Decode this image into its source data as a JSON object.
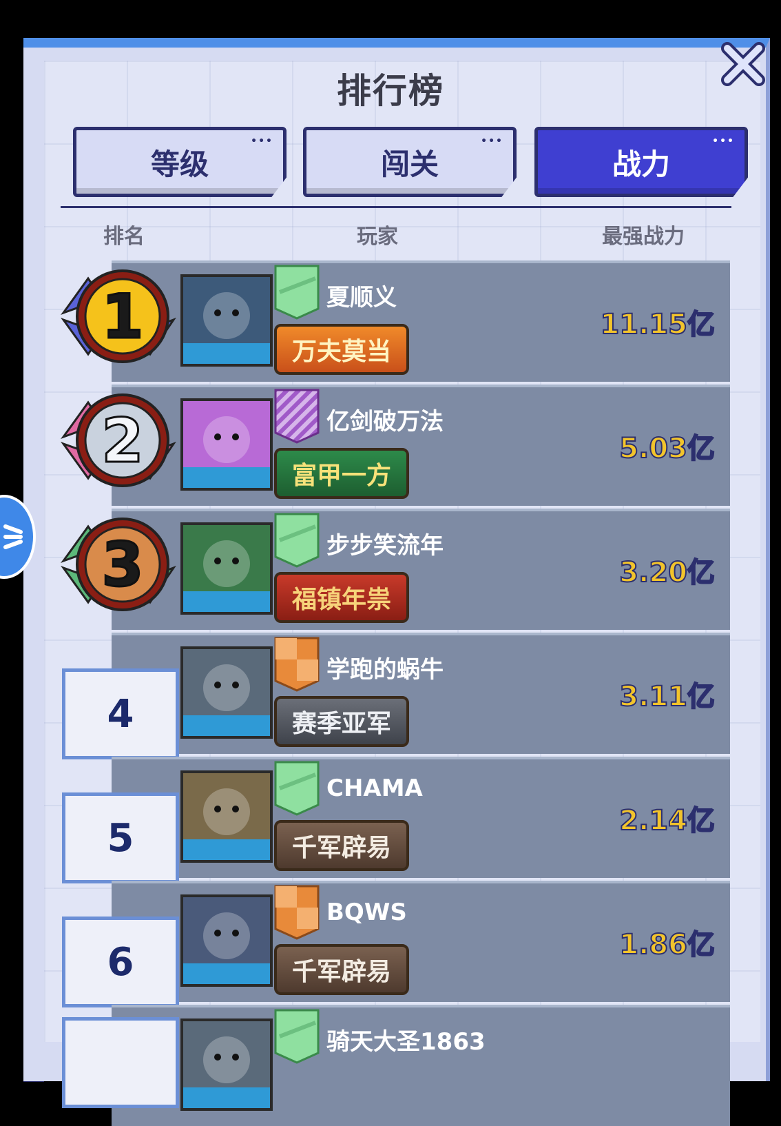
{
  "header": {
    "title": "排行榜"
  },
  "tabs": [
    {
      "label": "等级",
      "active": false
    },
    {
      "label": "闯关",
      "active": false
    },
    {
      "label": "战力",
      "active": true
    }
  ],
  "columns": {
    "rank": "排名",
    "player": "玩家",
    "power": "最强战力"
  },
  "colors": {
    "tab_active": "#3f3fd1",
    "tab_inactive": "#d7dbf5",
    "row_bg": "#7e8ba4",
    "power_text": "#f2c42c",
    "gold_medal": "#f5c21b",
    "silver_medal": "#c9d2de",
    "bronze_medal": "#d98b4b"
  },
  "rows": [
    {
      "rank": "1",
      "medal": "gold-medal-icon",
      "name": "夏顺义",
      "flag": "green-flag-icon",
      "badge": "万夫莫当",
      "badge_style": "orange",
      "power": "11.15亿",
      "avatar": "dragon-avatar-icon"
    },
    {
      "rank": "2",
      "medal": "silver-medal-icon",
      "name": "亿剑破万法",
      "flag": "purple-striped-flag-icon",
      "badge": "富甲一方",
      "badge_style": "green",
      "power": "5.03亿",
      "avatar": "pink-hair-avatar-icon"
    },
    {
      "rank": "3",
      "medal": "bronze-medal-icon",
      "name": "步步笑流年",
      "flag": "green-flag-icon",
      "badge": "福镇年祟",
      "badge_style": "red",
      "power": "3.20亿",
      "avatar": "clown-avatar-icon"
    },
    {
      "rank": "4",
      "medal": "",
      "name": "学跑的蜗牛",
      "flag": "orange-checkered-flag-icon",
      "badge": "赛季亚军",
      "badge_style": "gray",
      "power": "3.11亿",
      "avatar": "masked-avatar-icon"
    },
    {
      "rank": "5",
      "medal": "",
      "name": "CHAMA",
      "flag": "green-flag-icon",
      "badge": "千军辟易",
      "badge_style": "brown",
      "power": "2.14亿",
      "avatar": "old-man-avatar-icon"
    },
    {
      "rank": "6",
      "medal": "",
      "name": "BQWS",
      "flag": "orange-checkered-flag-icon",
      "badge": "千军辟易",
      "badge_style": "brown",
      "power": "1.86亿",
      "avatar": "bandana-avatar-icon"
    },
    {
      "rank": "",
      "medal": "",
      "name": "骑天大圣1863",
      "flag": "green-flag-icon",
      "badge": "",
      "badge_style": "",
      "power": "",
      "avatar": "partial-avatar-icon"
    }
  ]
}
